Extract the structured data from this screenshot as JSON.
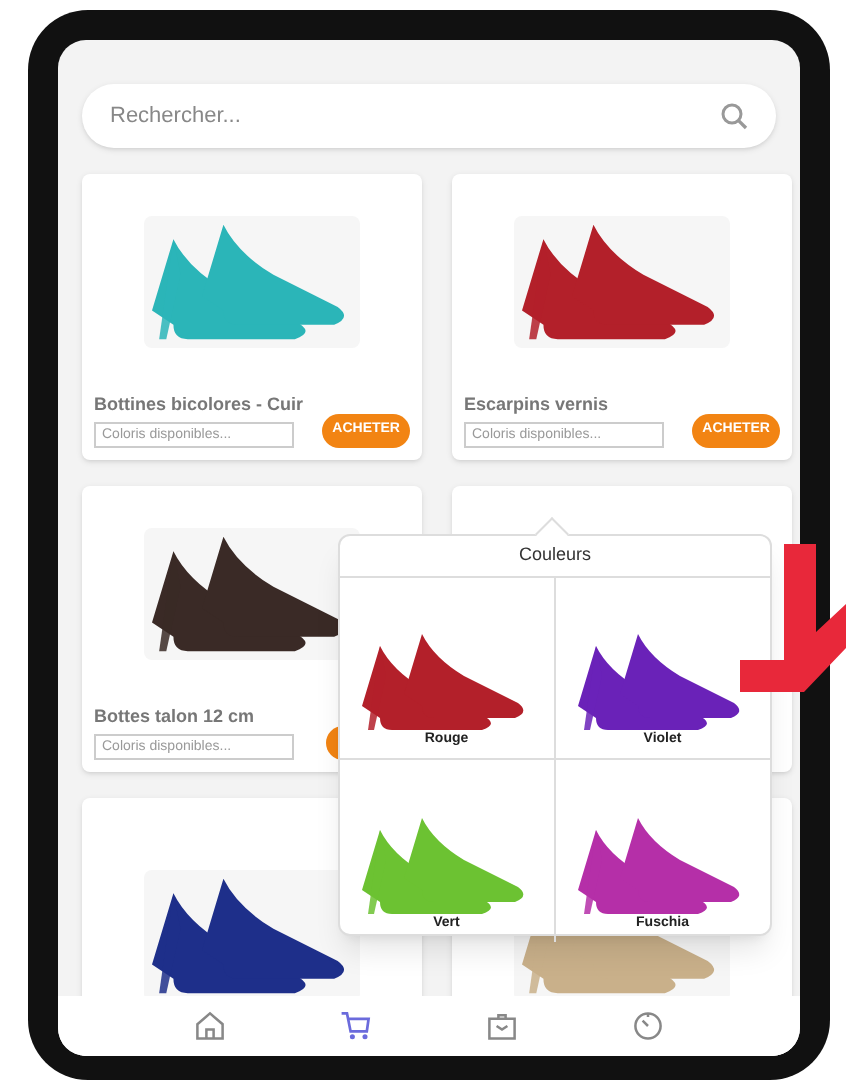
{
  "search": {
    "placeholder": "Rechercher..."
  },
  "products": [
    {
      "name": "Bottines bicolores - Cuir",
      "colors_field": {
        "placeholder": "Coloris disponibles..."
      },
      "buy_button": "ACHETER",
      "kind": "ankle-boots"
    },
    {
      "name": "Escarpins vernis",
      "colors_field": {
        "placeholder": "Coloris disponibles..."
      },
      "buy_button": "ACHETER",
      "kind": "red-pumps"
    },
    {
      "name": "Bottes talon 12 cm",
      "colors_field": {
        "placeholder": "Coloris disponibles..."
      },
      "kind": "tall-boots"
    },
    {
      "kind": "hidden"
    },
    {
      "kind": "blue-flats"
    },
    {
      "kind": "beige-shoes"
    }
  ],
  "color_popover": {
    "title": "Couleurs",
    "options": [
      {
        "label": "Rouge",
        "color": "#b3202a"
      },
      {
        "label": "Violet",
        "color": "#6a22b8"
      },
      {
        "label": "Vert",
        "color": "#6cc232"
      },
      {
        "label": "Fuschia",
        "color": "#b52fa8"
      }
    ]
  },
  "tab_bar": [
    {
      "kind": "home",
      "selected": false
    },
    {
      "kind": "cart",
      "selected": true
    },
    {
      "kind": "bag",
      "selected": false
    },
    {
      "kind": "timer",
      "selected": false
    }
  ]
}
